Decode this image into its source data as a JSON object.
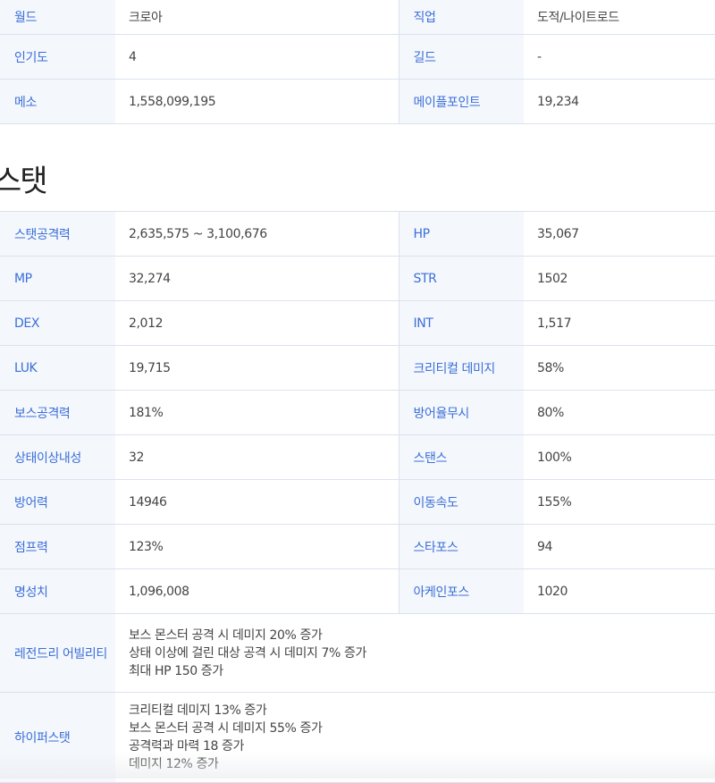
{
  "info": {
    "rows": [
      {
        "l1": "월드",
        "v1": "크로아",
        "l2": "직업",
        "v2": "도적/나이트로드"
      },
      {
        "l1": "인기도",
        "v1": "4",
        "l2": "길드",
        "v2": "-"
      },
      {
        "l1": "메소",
        "v1": "1,558,099,195",
        "l2": "메이플포인트",
        "v2": "19,234"
      }
    ]
  },
  "stat": {
    "title": "스탯",
    "rows": [
      {
        "l1": "스탯공격력",
        "v1": "2,635,575 ~ 3,100,676",
        "l2": "HP",
        "v2": "35,067"
      },
      {
        "l1": "MP",
        "v1": "32,274",
        "l2": "STR",
        "v2": "1502"
      },
      {
        "l1": "DEX",
        "v1": "2,012",
        "l2": "INT",
        "v2": "1,517"
      },
      {
        "l1": "LUK",
        "v1": "19,715",
        "l2": "크리티컬 데미지",
        "v2": "58%"
      },
      {
        "l1": "보스공격력",
        "v1": "181%",
        "l2": "방어율무시",
        "v2": "80%"
      },
      {
        "l1": "상태이상내성",
        "v1": "32",
        "l2": "스탠스",
        "v2": "100%"
      },
      {
        "l1": "방어력",
        "v1": "14946",
        "l2": "이동속도",
        "v2": "155%"
      },
      {
        "l1": "점프력",
        "v1": "123%",
        "l2": "스타포스",
        "v2": "94"
      },
      {
        "l1": "명성치",
        "v1": "1,096,008",
        "l2": "아케인포스",
        "v2": "1020"
      }
    ],
    "legendary": {
      "label": "레전드리 어빌리티",
      "lines": [
        "보스 몬스터 공격 시 데미지 20% 증가",
        "상태 이상에 걸린 대상 공격 시 데미지 7% 증가",
        "최대 HP 150 증가"
      ]
    },
    "hyper": {
      "label": "하이퍼스탯",
      "lines": [
        "크리티컬 데미지 13% 증가",
        "보스 몬스터 공격 시 데미지 55% 증가",
        "공격력과 마력 18 증가",
        "데미지 12% 증가"
      ]
    }
  }
}
